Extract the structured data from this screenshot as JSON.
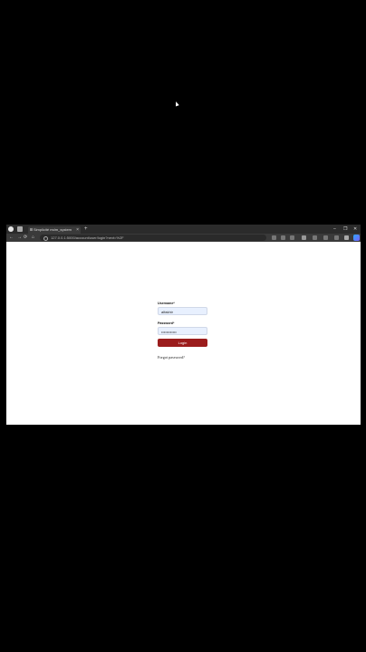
{
  "browser": {
    "tab_title": "Simplicité mdm_system",
    "tab_close": "×",
    "new_tab": "+",
    "window_controls": {
      "minimize": "–",
      "restore": "❐",
      "close": "✕"
    },
    "nav": {
      "back": "←",
      "forward": "→",
      "refresh": "⟳",
      "home": "⌂"
    },
    "address": "127.0.0.1:5000/account/user/login?next=%2F",
    "icons": {
      "browser_logo": "edge-profile-icon",
      "workspaces": "workspaces-icon",
      "copilot": "copilot-icon"
    }
  },
  "login": {
    "username_label": "Username*",
    "username_value": "alfakhir",
    "password_label": "Password*",
    "password_value": "••••••••••••",
    "button_label": "Login",
    "forgot_link": "Forgot password?",
    "accent_color": "#9b1c1c"
  }
}
